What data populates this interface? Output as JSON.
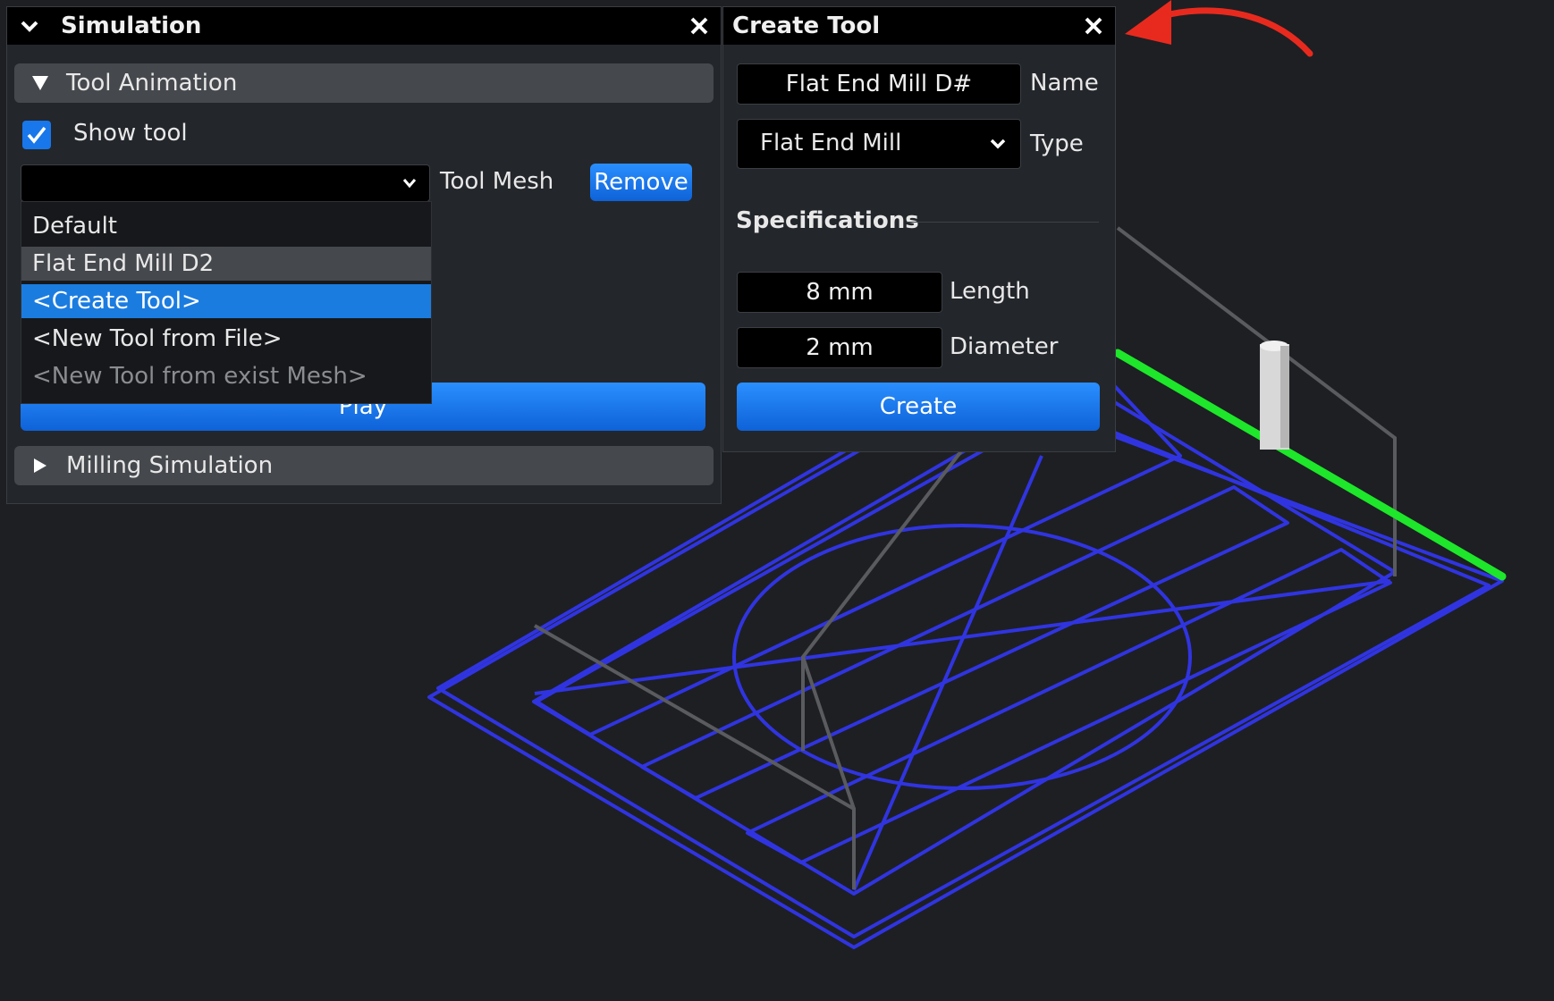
{
  "simulation_panel": {
    "title": "Simulation",
    "tool_animation": {
      "header": "Tool Animation",
      "show_tool": {
        "label": "Show tool",
        "checked": true
      },
      "tool_mesh_label": "Tool Mesh",
      "tool_mesh_value": "",
      "remove_label": "Remove",
      "play_label": "Play",
      "dropdown_options": [
        "Default",
        "Flat End Mill D2",
        "<Create Tool>",
        "<New Tool from File>",
        "<New Tool from exist Mesh>"
      ],
      "dropdown_selected": "<Create Tool>"
    },
    "milling_simulation": {
      "header": "Milling Simulation"
    }
  },
  "create_tool_panel": {
    "title": "Create Tool",
    "name_value": "Flat End Mill D#",
    "name_label": "Name",
    "type_value": "Flat End Mill",
    "type_label": "Type",
    "specifications_label": "Specifications",
    "length_value": "8 mm",
    "length_label": "Length",
    "diameter_value": "2 mm",
    "diameter_label": "Diameter",
    "create_label": "Create"
  },
  "colors": {
    "accent": "#1877ea",
    "toolpath": "#3034e0",
    "axis_highlight": "#1ee62a",
    "arrow": "#e82a1e"
  },
  "icons": [
    "chevron-down-icon",
    "close-icon",
    "triangle-down-icon",
    "triangle-right-icon",
    "checkmark-icon",
    "red-arrow-icon"
  ]
}
